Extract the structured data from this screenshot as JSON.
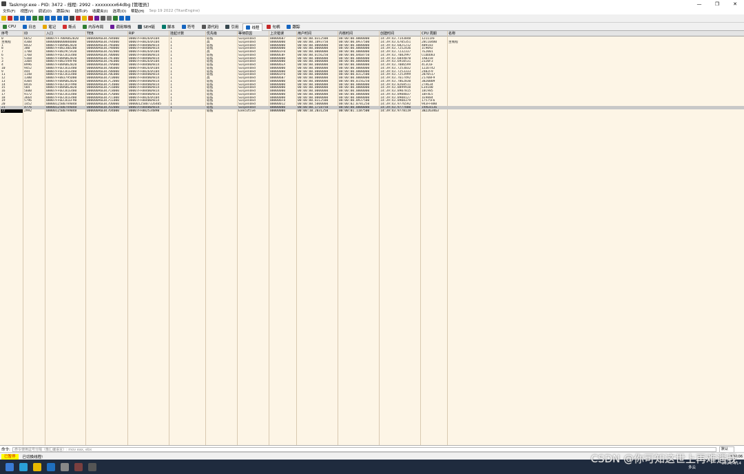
{
  "window": {
    "title": "Taskmgr.exe - PID: 3472 - 线程: 2992 - xxxxxxxx64dbg [管理员]",
    "minimize": "—",
    "maximize": "❐",
    "close": "✕"
  },
  "menu": [
    "文件(F)",
    "视图(V)",
    "调试(D)",
    "跟踪(N)",
    "插件(P)",
    "收藏夹(I)",
    "选项(O)",
    "帮助(H)",
    "Sep 19 2022 (TitanEngine)"
  ],
  "tabs": [
    {
      "label": "CPU",
      "icon": "cpu-icon",
      "color": "#2f7d32"
    },
    {
      "label": "日志",
      "icon": "log-icon",
      "color": "#1565c0"
    },
    {
      "label": "笔记",
      "icon": "notes-icon",
      "color": "#e6a700"
    },
    {
      "label": "断点",
      "icon": "breakpoint-icon",
      "color": "#d32f2f"
    },
    {
      "label": "内存布局",
      "icon": "memory-map-icon",
      "color": "#2f7d32"
    },
    {
      "label": "调用堆栈",
      "icon": "callstack-icon",
      "color": "#6a1b9a"
    },
    {
      "label": "SEH链",
      "icon": "seh-icon",
      "color": "#455a64"
    },
    {
      "label": "脚本",
      "icon": "script-icon",
      "color": "#00796b"
    },
    {
      "label": "符号",
      "icon": "symbols-icon",
      "color": "#1565c0"
    },
    {
      "label": "源代码",
      "icon": "source-icon",
      "color": "#555555"
    },
    {
      "label": "引用",
      "icon": "references-icon",
      "color": "#37474f"
    },
    {
      "label": "线程",
      "icon": "threads-icon",
      "color": "#1565c0",
      "active": true
    },
    {
      "label": "句柄",
      "icon": "handles-icon",
      "color": "#c62828"
    },
    {
      "label": "跟踪",
      "icon": "trace-icon",
      "color": "#1565c0"
    }
  ],
  "columns": [
    "序号",
    "ID",
    "入口",
    "TEB",
    "RIP",
    "挂起计数",
    "优先级",
    "等待原因",
    "上次错误",
    "用户时间",
    "内核时间",
    "创建时间",
    "CPU 周期",
    "名称"
  ],
  "rows": [
    [
      "0",
      "6652",
      "00007FF7B8A062B20",
      "000000A6E0C7B4000",
      "00007FFB8264A104",
      "1",
      "较低",
      "Suspended",
      "000006B7",
      "00:00:00.0312500",
      "00:00:00.0000000",
      "14:39:43.7143848",
      "12111AF",
      ""
    ],
    [
      "主线程",
      "4308",
      "0000000000000000",
      "000000A6E0C7A4000",
      "00007FFB8264A104",
      "1",
      "高",
      "Suspended",
      "00000000",
      "00:00:00.1093750",
      "00:00:00.0937500",
      "14:39:43.6705351",
      "28C10480",
      "主线程"
    ],
    [
      "1",
      "8432",
      "00007FFB8A062B20",
      "000000A6E0C7A6000",
      "00007FFB84B0A814",
      "1",
      "较低",
      "Suspended",
      "00000000",
      "00:00:00.0000000",
      "00:00:00.0000000",
      "14:39:43.6821212",
      "4B9183",
      ""
    ],
    [
      "8",
      "380",
      "00007FFB8230D2B0",
      "000000A6E0C7A8000",
      "00007FFB84B0A814",
      "1",
      "较低",
      "Suspended",
      "00000000",
      "00:00:00.0000000",
      "00:00:00.0000000",
      "14:39:43.7252436",
      "1C9092",
      ""
    ],
    [
      "7",
      "1788",
      "00007FFB829C5A30",
      "000000A6E0C7B2000",
      "00007FFB8264A104",
      "1",
      "高",
      "Suspended",
      "000003F0",
      "00:00:00.0000000",
      "00:00:00.0000000",
      "14:39:43.7232337",
      "7E2001",
      ""
    ],
    [
      "6",
      "1760",
      "00007FF6EC81E480",
      "000000A6E0C7B0000",
      "00007FFB84B0A814",
      "1",
      "较低",
      "Suspended",
      "00000EBF",
      "00:00:00.0156250",
      "00:00:00.0468750",
      "14:39:43.7082997",
      "CCDDD83",
      ""
    ],
    [
      "5",
      "5168",
      "00007FFB8A062B20",
      "000000A6E0C7AC000",
      "00007FFB84B0A814",
      "1",
      "较低",
      "Suspended",
      "00000000",
      "00:00:00.0000000",
      "00:00:00.0000000",
      "14:39:43.6844870",
      "1AB318",
      ""
    ],
    [
      "3",
      "3304",
      "00007FFB8259AF90",
      "000000A6E0C7AE000",
      "00007FFB8264A104",
      "1",
      "较低",
      "Suspended",
      "00000000",
      "00:00:00.0000000",
      "00:00:00.0000000",
      "14:39:43.6910531",
      "2320F3",
      ""
    ],
    [
      "4",
      "8996",
      "00007FFB8A062B20",
      "000000A6E0C7AA000",
      "00007FFB84B0A814",
      "1",
      "较低",
      "Suspended",
      "000006EA",
      "00:00:00.0000000",
      "00:00:00.0000000",
      "14:39:43.7086599",
      "4C3C6F",
      ""
    ],
    [
      "10",
      "9452",
      "00007FF6EC81E480",
      "000000A6E0C7B6000",
      "00007FFB8264A104",
      "1",
      "较低",
      "Suspended",
      "00000000",
      "00:00:00.0000000",
      "00:00:00.0000000",
      "14:39:43.7253032",
      "122D742",
      ""
    ],
    [
      "9",
      "444",
      "00007FF6EC81E480",
      "000000A6E0C7B8000",
      "00007FFB8264A104",
      "1",
      "较低",
      "Suspended",
      "00000000",
      "00:00:00.0000000",
      "00:00:00.0000000",
      "14:39:43.7253333",
      "24B2F9",
      ""
    ],
    [
      "11",
      "1148",
      "00007FF6EC81E480",
      "000000A6E0C7BE000",
      "00007FFB84B0A814",
      "1",
      "较低",
      "Suspended",
      "000003F0",
      "00:00:00.0000000",
      "00:00:00.0312500",
      "14:39:43.7253999",
      "2B70517",
      ""
    ],
    [
      "12",
      "1300",
      "00007FFB83795D00",
      "000000A6E0C7C0000",
      "00007FFB84B0A814",
      "1",
      "高",
      "Suspended",
      "000006B7",
      "00:00:00.0000000",
      "00:00:00.0000000",
      "14:39:43.7617492",
      "21708F9",
      ""
    ],
    [
      "13",
      "4304",
      "00007FFB8A062B20",
      "000000A6E0C7C2000",
      "00007FFB84B0A814",
      "1",
      "较低",
      "Suspended",
      "00000000",
      "00:00:00.0000000",
      "00:00:00.0156250",
      "14:39:43.7862830",
      "3B20B09",
      ""
    ],
    [
      "14",
      "8416",
      "00007FF6EC81F990",
      "000000A6E0C7C4000",
      "00007FFB84B0A814",
      "1",
      "较低",
      "Suspended",
      "00000000",
      "00:00:00.0000000",
      "00:00:00.0000000",
      "14:39:43.8268511",
      "27A634",
      ""
    ],
    [
      "15",
      "584",
      "00007FFB8A062B20",
      "000000A6E0C7C6000",
      "00007FFB84B0A814",
      "1",
      "较低",
      "Suspended",
      "00000000",
      "00:00:00.0000000",
      "00:00:00.0000000",
      "14:39:43.8899938",
      "E34180",
      ""
    ],
    [
      "16",
      "5600",
      "00007FF6EC81E480",
      "000000A6E0C7C8000",
      "00007FFB84B0A814",
      "1",
      "较低",
      "Suspended",
      "00000000",
      "00:00:00.0000000",
      "00:00:00.0000000",
      "14:39:43.8907815",
      "18C985",
      ""
    ],
    [
      "17",
      "9172",
      "00007FF6EC81E480",
      "000000A6E0C7CA000",
      "00007FFB84B0A814",
      "1",
      "较低",
      "Suspended",
      "00000000",
      "00:00:00.0000000",
      "00:00:00.0000000",
      "14:39:43.8908037",
      "1BF4E5",
      ""
    ],
    [
      "18",
      "3664",
      "00007FF6EC81E480",
      "000000A6E0C7CC000",
      "00007FFB8264A104",
      "1",
      "较低",
      "Suspended",
      "00000000",
      "00:00:00.0000000",
      "00:00:00.0000000",
      "14:39:43.8908127",
      "1E9884",
      ""
    ],
    [
      "19",
      "5796",
      "00007FF6EC81EF90",
      "000000A6E0C7CE000",
      "00007FFB84B0A814",
      "1",
      "较低",
      "Suspended",
      "000006F8",
      "00:00:00.0312500",
      "00:00:00.0937500",
      "14:39:43.8908379",
      "17575F6",
      ""
    ],
    [
      "20",
      "1452",
      "00000125B07AAB48",
      "000000A6E0C7D0000",
      "00000125B07326405",
      "1",
      "较低",
      "Suspended",
      "00000012",
      "00:00:00.5000000",
      "00:00:02.0781250",
      "14:39:43.9776592",
      "943FF880",
      ""
    ],
    [
      "21",
      "4776",
      "00000125B07AAB48",
      "000000A6E0C7D2000",
      "00007FFB84B0A814",
      "1",
      "较低",
      "Suspended",
      "00000000",
      "00:00:00.1718750",
      "00:00:00.0000000",
      "14:39:43.9777800",
      "19AE8136",
      ""
    ],
    [
      "22",
      "2992",
      "00000125B07AAB48",
      "000000A6E0C7D4000",
      "00007FFB8253489B",
      "1",
      "较低",
      "Executive",
      "00000000",
      "00:00:10.2031250",
      "00:00:01.1187500",
      "14:39:43.9778119",
      "3B2263463",
      ""
    ]
  ],
  "selected_row": 21,
  "current_row": 22,
  "command": {
    "label": "命令:",
    "placeholder": "命令使用逗号分隔（像汇编语言）: mov eax, ebx",
    "default": "默认"
  },
  "status": {
    "state": "已暂停",
    "message": "已切换线程!",
    "time": "0:00:06"
  },
  "taskbar": {
    "weather": "多云",
    "clock": "2024/4/14"
  },
  "watermark": "CSDN @你可知这世上再难遇我"
}
